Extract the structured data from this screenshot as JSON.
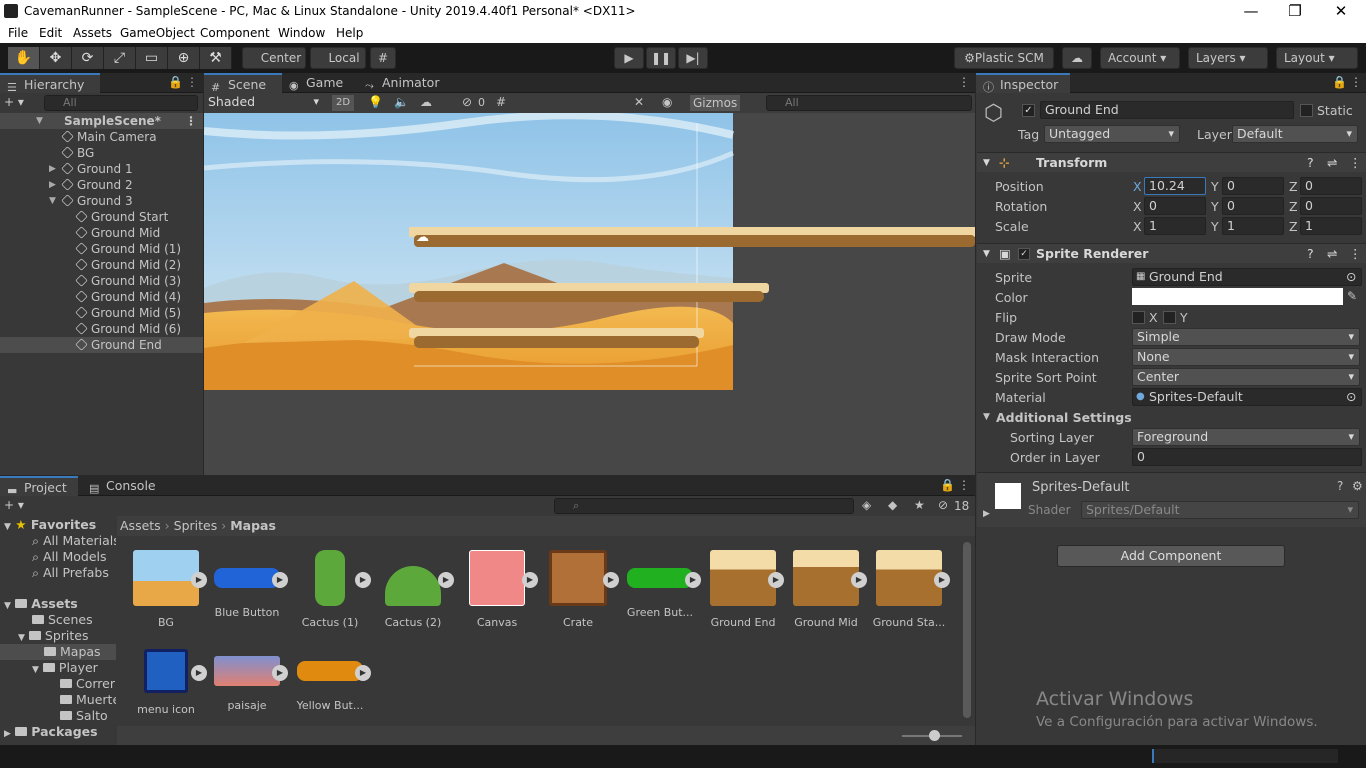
{
  "window": {
    "title": "CavemanRunner - SampleScene - PC, Mac & Linux Standalone - Unity 2019.4.40f1 Personal* <DX11>",
    "min": "—",
    "max": "❐",
    "close": "✕"
  },
  "menu": [
    "File",
    "Edit",
    "Assets",
    "GameObject",
    "Component",
    "Window",
    "Help"
  ],
  "toolbar": {
    "pivot": "Center",
    "space": "Local",
    "plastic": "Plastic SCM",
    "account": "Account",
    "layers": "Layers",
    "layout": "Layout"
  },
  "hierarchy": {
    "tab": "Hierarchy",
    "search_placeholder": "All",
    "scene": "SampleScene*",
    "items": [
      "Main Camera",
      "BG",
      "Ground 1",
      "Ground 2",
      "Ground 3",
      "Ground Start",
      "Ground Mid",
      "Ground Mid (1)",
      "Ground Mid (2)",
      "Ground Mid (3)",
      "Ground Mid (4)",
      "Ground Mid (5)",
      "Ground Mid (6)",
      "Ground End"
    ]
  },
  "scene_tabs": {
    "scene": "Scene",
    "game": "Game",
    "animator": "Animator",
    "shading": "Shaded",
    "mode2d": "2D",
    "hidden_count": "0",
    "gizmos": "Gizmos",
    "search_placeholder": "All"
  },
  "inspector": {
    "tab": "Inspector",
    "name": "Ground End",
    "static": "Static",
    "tag_label": "Tag",
    "tag": "Untagged",
    "layer_label": "Layer",
    "layer": "Default",
    "transform": {
      "title": "Transform",
      "position": "Position",
      "rotation": "Rotation",
      "scale": "Scale",
      "px": "10.24",
      "py": "0",
      "pz": "0",
      "rx": "0",
      "ry": "0",
      "rz": "0",
      "sx": "1",
      "sy": "1",
      "sz": "1"
    },
    "sprite_renderer": {
      "title": "Sprite Renderer",
      "sprite_label": "Sprite",
      "sprite": "Ground End",
      "color_label": "Color",
      "flip_label": "Flip",
      "flip_x": "X",
      "flip_y": "Y",
      "draw_mode_label": "Draw Mode",
      "draw_mode": "Simple",
      "mask_label": "Mask Interaction",
      "mask": "None",
      "sort_point_label": "Sprite Sort Point",
      "sort_point": "Center",
      "material_label": "Material",
      "material": "Sprites-Default",
      "additional": "Additional Settings",
      "sorting_layer_label": "Sorting Layer",
      "sorting_layer": "Foreground",
      "order_label": "Order in Layer",
      "order": "0"
    },
    "material_block": {
      "name": "Sprites-Default",
      "shader_label": "Shader",
      "shader": "Sprites/Default"
    },
    "add_component": "Add Component",
    "watermark_title": "Activar Windows",
    "watermark_sub": "Ve a Configuración para activar Windows."
  },
  "project": {
    "tab_project": "Project",
    "tab_console": "Console",
    "hidden_count": "18",
    "tree": {
      "favorites": "Favorites",
      "fav_items": [
        "All Materials",
        "All Models",
        "All Prefabs"
      ],
      "assets": "Assets",
      "scenes": "Scenes",
      "sprites": "Sprites",
      "mapas": "Mapas",
      "player": "Player",
      "player_items": [
        "Correr",
        "Muerte",
        "Salto"
      ],
      "packages": "Packages"
    },
    "breadcrumb": [
      "Assets",
      "Sprites",
      "Mapas"
    ],
    "assets": [
      "BG",
      "Blue Button",
      "Cactus (1)",
      "Cactus (2)",
      "Canvas",
      "Crate",
      "Green But...",
      "Ground End",
      "Ground Mid",
      "Ground Sta...",
      "menu icon",
      "paisaje",
      "Yellow But..."
    ]
  }
}
